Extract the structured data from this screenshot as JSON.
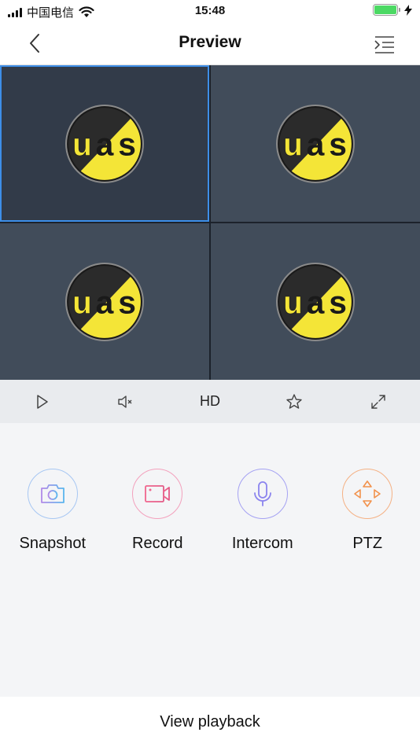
{
  "status_bar": {
    "carrier": "中国电信",
    "time": "15:48",
    "battery_percent": 100
  },
  "nav": {
    "title": "Preview",
    "back_icon": "chevron-left-icon",
    "menu_icon": "list-menu-icon"
  },
  "video_grid": {
    "selected_index": 0,
    "cells": [
      {
        "logo_text": "uas"
      },
      {
        "logo_text": "uas"
      },
      {
        "logo_text": "uas"
      },
      {
        "logo_text": "uas"
      }
    ]
  },
  "controls": {
    "play_icon": "play-icon",
    "mute_icon": "speaker-muted-icon",
    "quality_label": "HD",
    "favorite_icon": "star-icon",
    "fullscreen_icon": "expand-icon"
  },
  "actions": [
    {
      "label": "Snapshot",
      "icon": "camera-icon",
      "color": "#7b9cf0"
    },
    {
      "label": "Record",
      "icon": "video-camera-icon",
      "color": "#ee6f94"
    },
    {
      "label": "Intercom",
      "icon": "microphone-icon",
      "color": "#8c84ee"
    },
    {
      "label": "PTZ",
      "icon": "direction-arrows-icon",
      "color": "#f2924c"
    }
  ],
  "bottom": {
    "label": "View playback"
  },
  "colors": {
    "accent": "#3d8ee8",
    "grid_bg": "#414c5a",
    "selected_bg": "#323b49",
    "logo_yellow": "#f4e537"
  }
}
